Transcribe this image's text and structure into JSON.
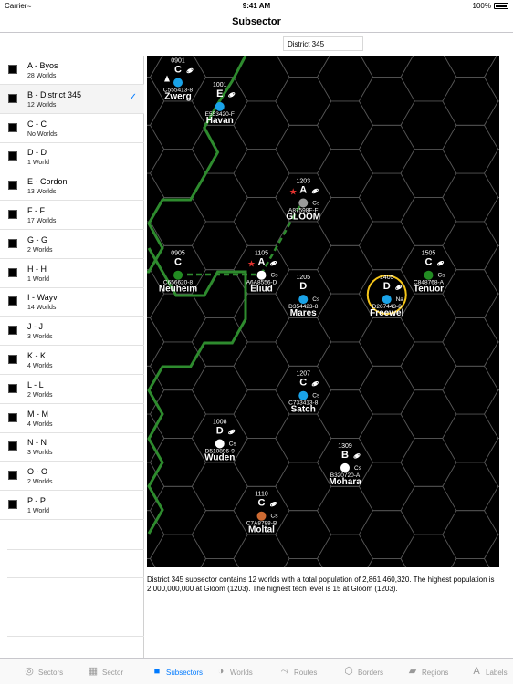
{
  "status": {
    "carrier": "Carrier",
    "time": "9:41 AM",
    "battery": "100%"
  },
  "nav": {
    "title": "Subsector"
  },
  "search": {
    "value": "District 345"
  },
  "sidebar": {
    "items": [
      {
        "name": "A - Byos",
        "count": "28 Worlds",
        "selected": false
      },
      {
        "name": "B - District 345",
        "count": "12 Worlds",
        "selected": true
      },
      {
        "name": "C - C",
        "count": "No Worlds",
        "selected": false
      },
      {
        "name": "D - D",
        "count": "1 World",
        "selected": false
      },
      {
        "name": "E - Cordon",
        "count": "13 Worlds",
        "selected": false
      },
      {
        "name": "F - F",
        "count": "17 Worlds",
        "selected": false
      },
      {
        "name": "G - G",
        "count": "2 Worlds",
        "selected": false
      },
      {
        "name": "H - H",
        "count": "1 World",
        "selected": false
      },
      {
        "name": "I - Wayv",
        "count": "14 Worlds",
        "selected": false
      },
      {
        "name": "J - J",
        "count": "3 Worlds",
        "selected": false
      },
      {
        "name": "K - K",
        "count": "4 Worlds",
        "selected": false
      },
      {
        "name": "L - L",
        "count": "2 Worlds",
        "selected": false
      },
      {
        "name": "M - M",
        "count": "4 Worlds",
        "selected": false
      },
      {
        "name": "N - N",
        "count": "3 Worlds",
        "selected": false
      },
      {
        "name": "O - O",
        "count": "2 Worlds",
        "selected": false
      },
      {
        "name": "P - P",
        "count": "1 World",
        "selected": false
      }
    ]
  },
  "worlds": [
    {
      "hex": "0901",
      "starport": "C",
      "uwp": "C555413-8",
      "name": "Zwerg",
      "color": "#1aa3e8",
      "gas_giant": true,
      "red_star": false,
      "travel_marker": true,
      "base": "",
      "amber": false
    },
    {
      "hex": "1001",
      "starport": "E",
      "uwp": "E553420-F",
      "name": "Havan",
      "color": "#1aa3e8",
      "gas_giant": true,
      "red_star": false,
      "travel_marker": false,
      "base": "",
      "amber": false
    },
    {
      "hex": "1203",
      "starport": "A",
      "uwp": "A87598F-F",
      "name": "GLOOM",
      "color": "#9a9a9a",
      "gas_giant": true,
      "red_star": true,
      "travel_marker": false,
      "base": "Cs",
      "amber": false
    },
    {
      "hex": "0905",
      "starport": "C",
      "uwp": "C656620-8",
      "name": "Neuheim",
      "color": "#228b22",
      "gas_giant": false,
      "red_star": false,
      "travel_marker": false,
      "base": "",
      "amber": false
    },
    {
      "hex": "1105",
      "starport": "A",
      "uwp": "A6A8556-D",
      "name": "Eliud",
      "color": "#ffffff",
      "gas_giant": true,
      "red_star": true,
      "travel_marker": false,
      "base": "Cs",
      "amber": false
    },
    {
      "hex": "1205",
      "starport": "D",
      "uwp": "D354423-8",
      "name": "Mares",
      "color": "#1aa3e8",
      "gas_giant": false,
      "red_star": false,
      "travel_marker": false,
      "base": "Cs",
      "amber": false
    },
    {
      "hex": "1405",
      "starport": "D",
      "uwp": "D267443-8",
      "name": "Freewel",
      "color": "#1aa3e8",
      "gas_giant": true,
      "red_star": false,
      "travel_marker": false,
      "base": "Na",
      "amber": true
    },
    {
      "hex": "1505",
      "starport": "C",
      "uwp": "C848768-A",
      "name": "Tenuor",
      "color": "#228b22",
      "gas_giant": true,
      "red_star": false,
      "travel_marker": false,
      "base": "Cs",
      "amber": false
    },
    {
      "hex": "1207",
      "starport": "C",
      "uwp": "C733413-8",
      "name": "Satch",
      "color": "#1aa3e8",
      "gas_giant": true,
      "red_star": false,
      "travel_marker": false,
      "base": "Cs",
      "amber": false
    },
    {
      "hex": "1008",
      "starport": "D",
      "uwp": "D510896-9",
      "name": "Wuden",
      "color": "#ffffff",
      "gas_giant": true,
      "red_star": false,
      "travel_marker": false,
      "base": "Cs",
      "amber": false
    },
    {
      "hex": "1309",
      "starport": "B",
      "uwp": "B320720-A",
      "name": "Mohara",
      "color": "#ffffff",
      "gas_giant": true,
      "red_star": false,
      "travel_marker": false,
      "base": "Cs",
      "amber": false
    },
    {
      "hex": "1110",
      "starport": "C",
      "uwp": "C7A8788-B",
      "name": "Moltal",
      "color": "#cd6a32",
      "gas_giant": true,
      "red_star": false,
      "travel_marker": false,
      "base": "Cs",
      "amber": false
    }
  ],
  "colors": {
    "border": "#2e8b2e",
    "route": "#2e8b2e",
    "red_star": "#e0322e",
    "amber": "#f5c518",
    "accent": "#007aff"
  },
  "description": "District 345 subsector contains 12 worlds with a total population of 2,861,460,320. The highest population is 2,000,000,000 at Gloom (1203). The highest tech level is 15 at Gloom (1203).",
  "tabs": [
    {
      "label": "Sectors",
      "icon": "sectors-icon",
      "active": false
    },
    {
      "label": "Sector",
      "icon": "grid-icon",
      "active": false
    },
    {
      "label": "Subsectors",
      "icon": "square-icon",
      "active": true
    },
    {
      "label": "Worlds",
      "icon": "globe-icon",
      "active": false
    },
    {
      "label": "Routes",
      "icon": "route-icon",
      "active": false
    },
    {
      "label": "Borders",
      "icon": "borders-icon",
      "active": false
    },
    {
      "label": "Regions",
      "icon": "regions-icon",
      "active": false
    },
    {
      "label": "Labels",
      "icon": "labels-icon",
      "active": false
    }
  ]
}
